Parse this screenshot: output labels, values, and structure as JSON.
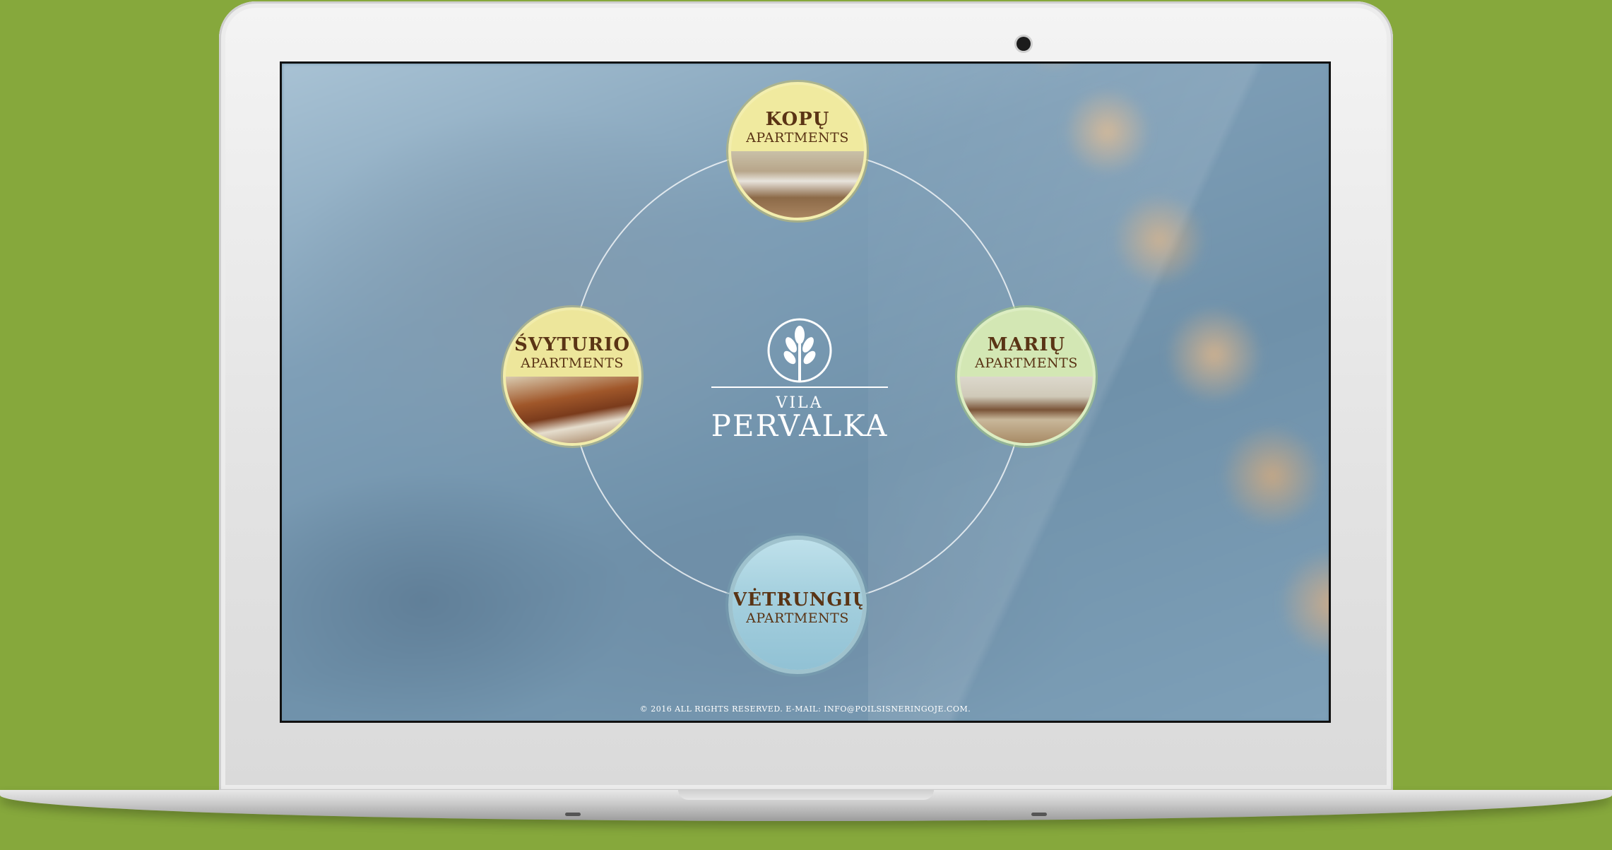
{
  "site": {
    "logo": {
      "small": "VILA",
      "big": "PERVALKA"
    },
    "apartments": [
      {
        "name": "KOPŲ",
        "sub": "APARTMENTS"
      },
      {
        "name": "ŠVYTURIO",
        "sub": "APARTMENTS"
      },
      {
        "name": "MARIŲ",
        "sub": "APARTMENTS"
      },
      {
        "name": "VĖTRUNGIŲ",
        "sub": "APARTMENTS"
      }
    ],
    "footer": "© 2016 ALL RIGHTS RESERVED. E-MAIL: INFO@POILSISNERINGOJE.COM."
  },
  "colors": {
    "page_background": "#86a83c",
    "caption_text": "#5a3415"
  }
}
